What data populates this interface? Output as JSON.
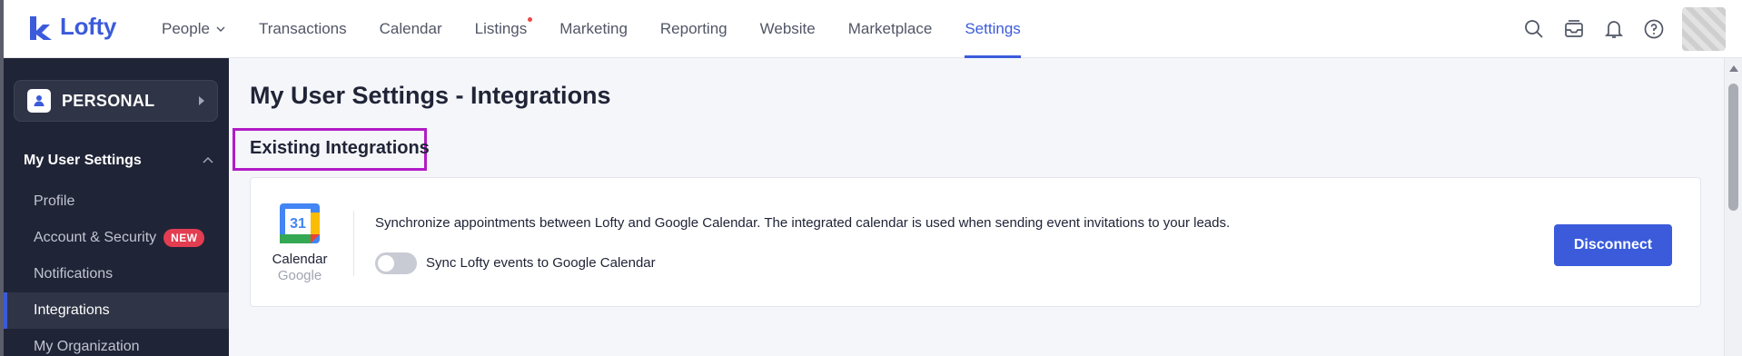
{
  "app": {
    "name": "Lofty",
    "brand_color": "#3b5bdb"
  },
  "nav": {
    "items": [
      {
        "label": "People",
        "has_dropdown": true
      },
      {
        "label": "Transactions"
      },
      {
        "label": "Calendar"
      },
      {
        "label": "Listings",
        "has_notification_dot": true
      },
      {
        "label": "Marketing"
      },
      {
        "label": "Reporting"
      },
      {
        "label": "Website"
      },
      {
        "label": "Marketplace"
      },
      {
        "label": "Settings",
        "active": true
      }
    ],
    "icons": [
      "search-icon",
      "inbox-icon",
      "bell-icon",
      "help-icon"
    ]
  },
  "sidebar": {
    "workspace_label": "PERSONAL",
    "section_title": "My User Settings",
    "items": [
      {
        "label": "Profile"
      },
      {
        "label": "Account & Security",
        "badge": "NEW"
      },
      {
        "label": "Notifications"
      },
      {
        "label": "Integrations",
        "active": true
      },
      {
        "label": "My Organization"
      }
    ]
  },
  "main": {
    "page_title": "My User Settings - Integrations",
    "section_heading": "Existing Integrations",
    "integration": {
      "logo_text": "31",
      "provider_name": "Calendar",
      "provider_sub": "Google",
      "description": "Synchronize appointments between Lofty and Google Calendar. The integrated calendar is used when sending event invitations to your leads.",
      "toggle_label": "Sync Lofty events to Google Calendar",
      "toggle_on": false,
      "action_label": "Disconnect"
    }
  },
  "colors": {
    "highlight": "#b11bc6",
    "sidebar_bg": "#202437",
    "badge_new": "#e33d51"
  }
}
